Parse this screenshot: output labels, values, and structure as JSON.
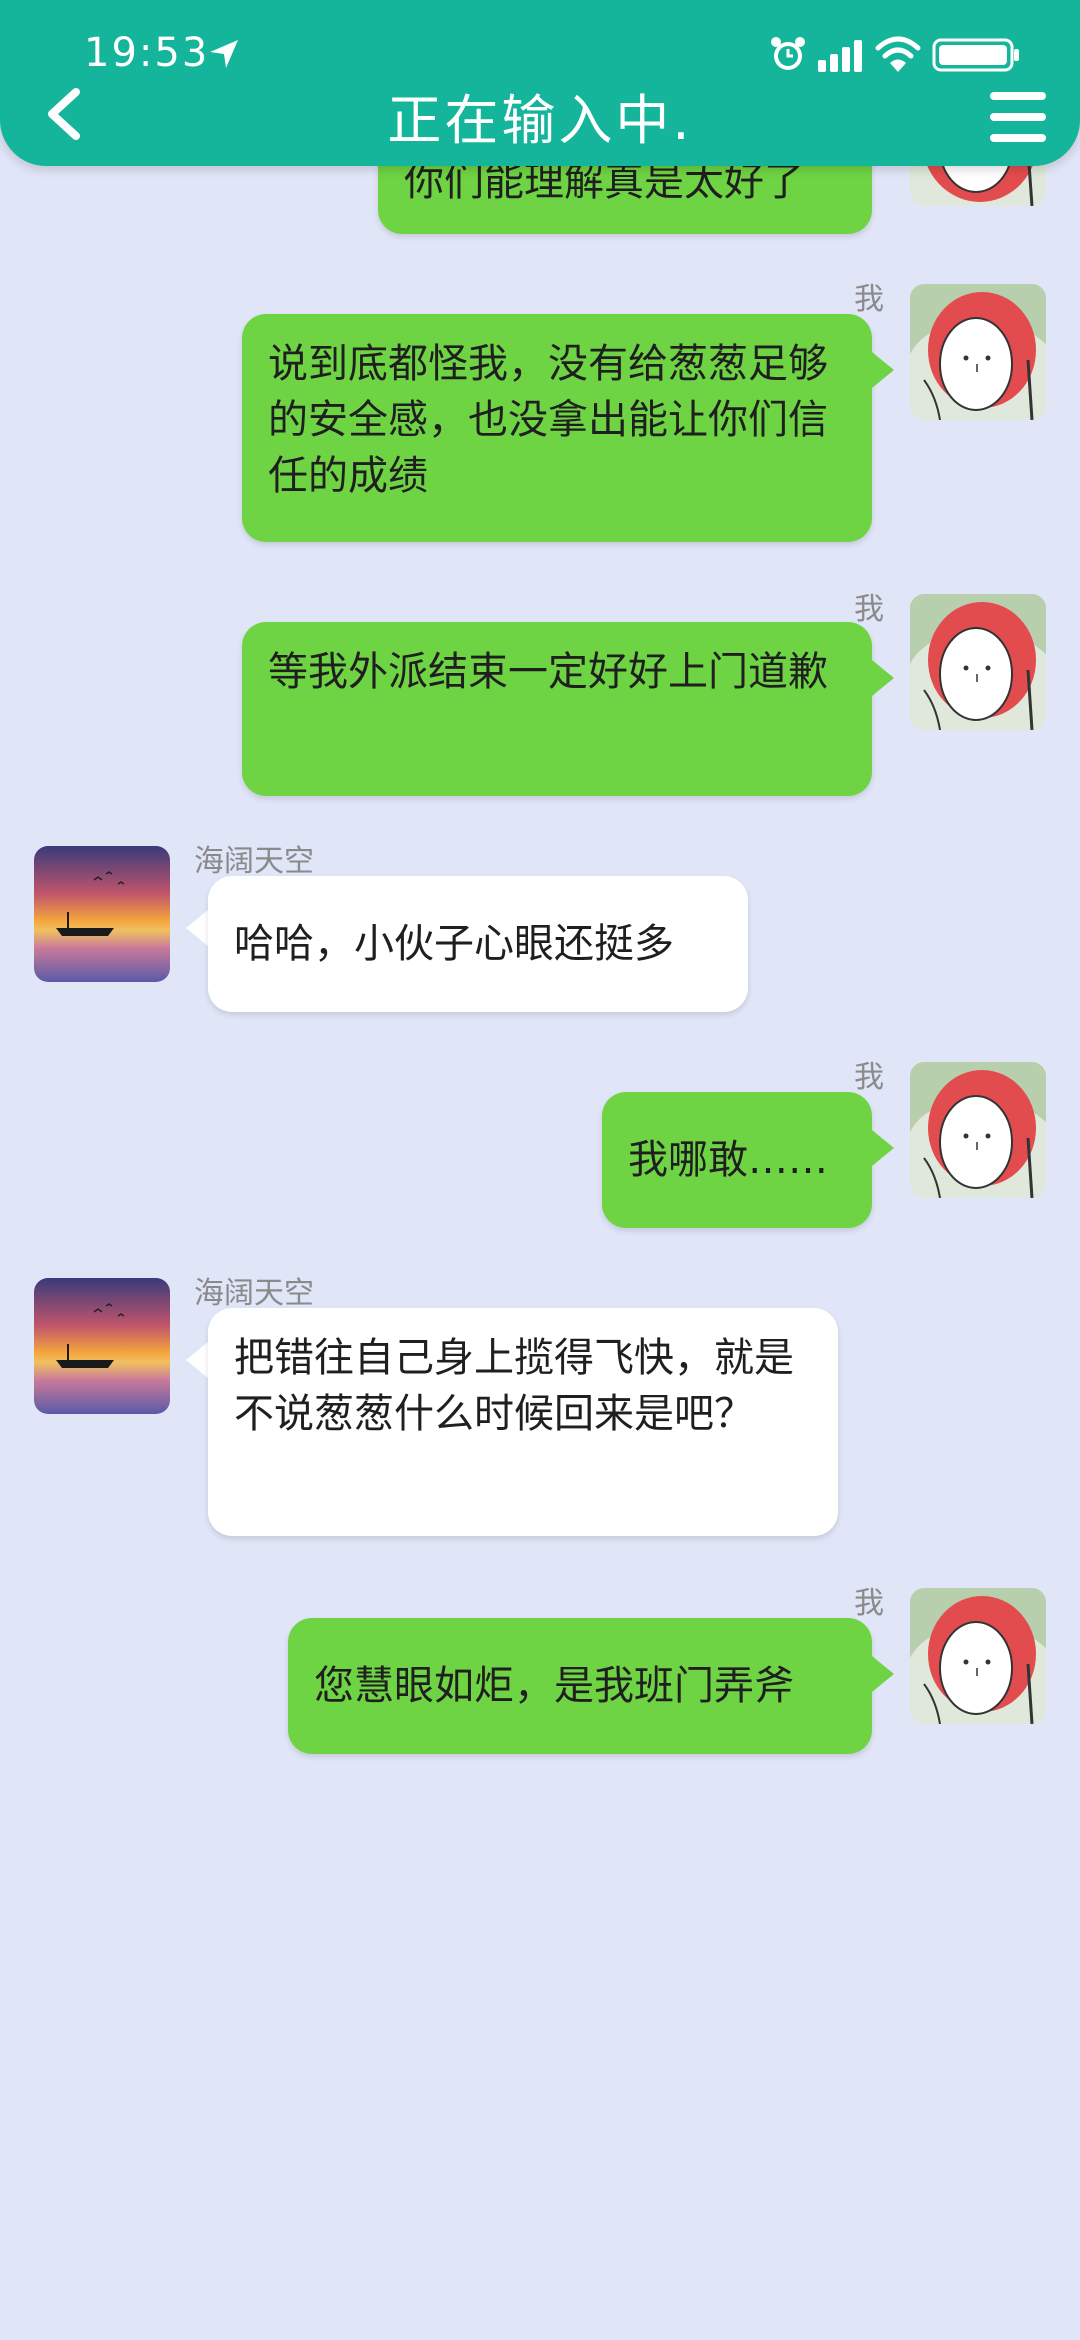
{
  "status_bar": {
    "time": "19:53"
  },
  "header": {
    "title": "正在输入中."
  },
  "messages": [
    {
      "sender": "self",
      "text": "你们能理解真是太好了"
    },
    {
      "sender": "self",
      "name": "我",
      "text": "说到底都怪我，没有给葱葱足够的安全感，也没拿出能让你们信任的成绩"
    },
    {
      "sender": "self",
      "name": "我",
      "text": "等我外派结束一定好好上门道歉"
    },
    {
      "sender": "other",
      "name": "海阔天空",
      "text": "哈哈，小伙子心眼还挺多"
    },
    {
      "sender": "self",
      "name": "我",
      "text": "我哪敢……"
    },
    {
      "sender": "other",
      "name": "海阔天空",
      "text": "把错往自己身上揽得飞快，就是不说葱葱什么时候回来是吧？"
    },
    {
      "sender": "self",
      "name": "我",
      "text": "您慧眼如炬，是我班门弄斧"
    }
  ],
  "colors": {
    "header": "#14b59b",
    "out_bubble": "#6fd443",
    "in_bubble": "#ffffff",
    "background": "#e0e6f7"
  }
}
